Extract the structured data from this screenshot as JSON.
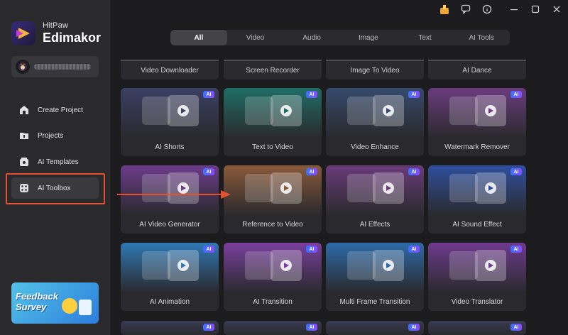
{
  "app": {
    "brand_small": "HitPaw",
    "brand_big": "Edimakor"
  },
  "sidebar": {
    "items": [
      {
        "label": "Create Project",
        "icon": "create-project-icon"
      },
      {
        "label": "Projects",
        "icon": "projects-icon"
      },
      {
        "label": "AI Templates",
        "icon": "ai-templates-icon"
      },
      {
        "label": "AI Toolbox",
        "icon": "ai-toolbox-icon"
      }
    ],
    "feedback": "Feedback Survey"
  },
  "tabs": [
    "All",
    "Video",
    "Audio",
    "Image",
    "Text",
    "AI Tools"
  ],
  "active_tab": "All",
  "toprow": [
    "Video Downloader",
    "Screen Recorder",
    "Image To Video",
    "AI Dance"
  ],
  "cards": [
    {
      "label": "AI Shorts",
      "badge": "AI",
      "theme": "#3b3f63"
    },
    {
      "label": "Text to Video",
      "badge": "AI",
      "theme": "#1f6e66"
    },
    {
      "label": "Video Enhance",
      "badge": "AI",
      "theme": "#364a6c"
    },
    {
      "label": "Watermark Remover",
      "badge": "AI",
      "theme": "#6b3b7e"
    },
    {
      "label": "AI Video Generator",
      "badge": "AI",
      "theme": "#6c3c8a"
    },
    {
      "label": "Reference to Video",
      "badge": "AI",
      "theme": "#8a5a3a"
    },
    {
      "label": "AI Effects",
      "badge": "AI",
      "theme": "#6a3b7a"
    },
    {
      "label": "AI Sound Effect",
      "badge": "AI",
      "theme": "#2f4f9e"
    },
    {
      "label": "AI Animation",
      "badge": "AI",
      "theme": "#2f78b4"
    },
    {
      "label": "AI Transition",
      "badge": "AI",
      "theme": "#7a3f9e"
    },
    {
      "label": "Multi Frame Transition",
      "badge": "AI",
      "theme": "#2d6aa8"
    },
    {
      "label": "Video Translator",
      "badge": "AI",
      "theme": "#6e3a8e"
    }
  ],
  "partial_badges": [
    "AI",
    "AI",
    "AI",
    "AI"
  ],
  "accent": "#e2522e"
}
